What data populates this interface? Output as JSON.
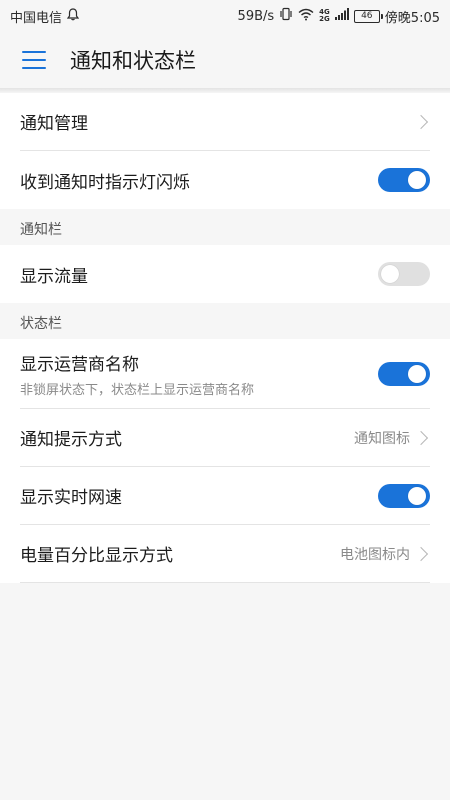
{
  "status_bar": {
    "carrier": "中国电信",
    "speed": "59B/s",
    "signal_top": "4G",
    "signal_bottom": "2G",
    "battery": "46",
    "time": "傍晚5:05"
  },
  "app_bar": {
    "title": "通知和状态栏"
  },
  "group1": {
    "items": [
      {
        "title": "通知管理"
      },
      {
        "title": "收到通知时指示灯闪烁",
        "toggle": true
      }
    ]
  },
  "section_notification_bar": {
    "header": "通知栏",
    "items": [
      {
        "title": "显示流量",
        "toggle": false
      }
    ]
  },
  "section_status_bar": {
    "header": "状态栏",
    "items": [
      {
        "title": "显示运营商名称",
        "subtitle": "非锁屏状态下，状态栏上显示运营商名称",
        "toggle": true
      },
      {
        "title": "通知提示方式",
        "value": "通知图标"
      },
      {
        "title": "显示实时网速",
        "toggle": true
      },
      {
        "title": "电量百分比显示方式",
        "value": "电池图标内"
      }
    ]
  },
  "colors": {
    "accent": "#1a73d9",
    "toggle_off": "#e0e0e0",
    "background": "#f6f6f6"
  }
}
